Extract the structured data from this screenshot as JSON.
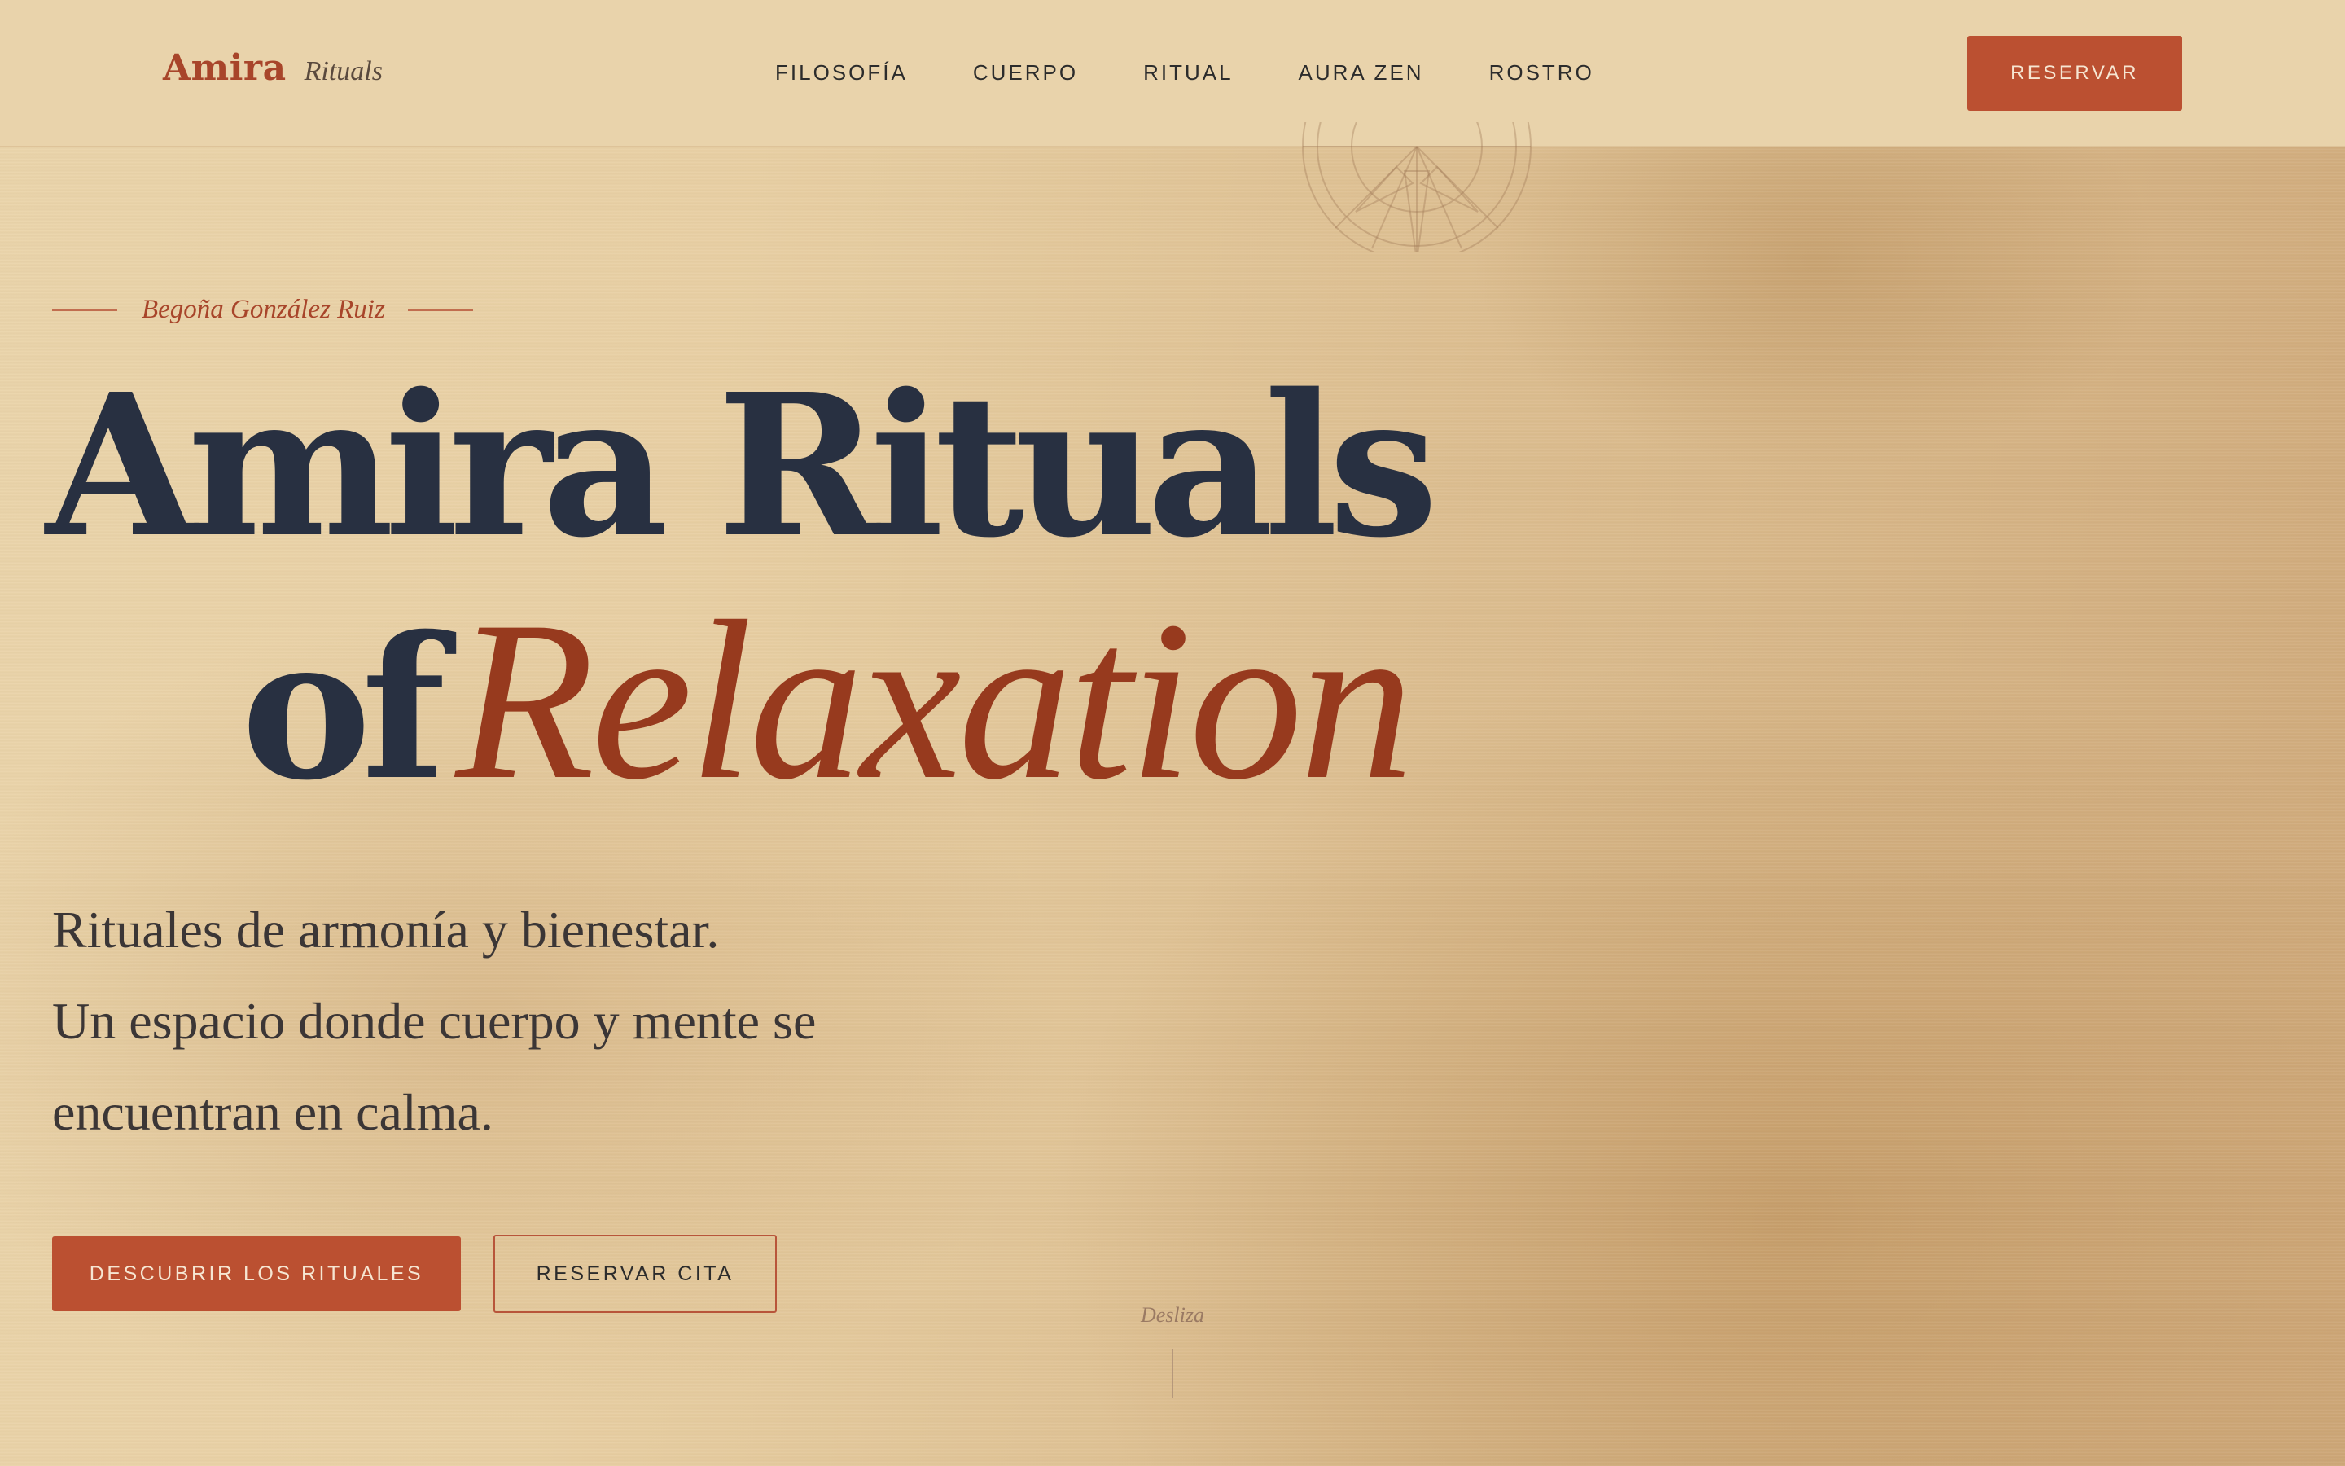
{
  "nav": {
    "brand_name": "Amira",
    "brand_tag": "Rituals",
    "items": [
      {
        "label": "FILOSOFÍA"
      },
      {
        "label": "CUERPO"
      },
      {
        "label": "RITUAL"
      },
      {
        "label": "AURA ZEN"
      },
      {
        "label": "ROSTRO"
      }
    ],
    "reserve_label": "RESERVAR"
  },
  "hero": {
    "eyebrow": "Begoña González Ruiz",
    "title_line1": "Amira Rituals",
    "title_of": "of",
    "title_accent": "Relaxation",
    "subtitle_lines": [
      "Rituales de armonía y bienestar.",
      "Un espacio donde cuerpo y mente se",
      "encuentran en calma."
    ],
    "primary_button": "DESCUBRIR LOS RITUALES",
    "secondary_button": "RESERVAR CITA",
    "scroll_hint": "Desliza"
  },
  "icons": {
    "compass": "compass-rose-icon",
    "scroll": "scroll-line-icon"
  },
  "colors": {
    "accent": "#bb5031",
    "accent_text": "#973a1e",
    "heading": "#283041",
    "background": "#e8cfa3"
  }
}
